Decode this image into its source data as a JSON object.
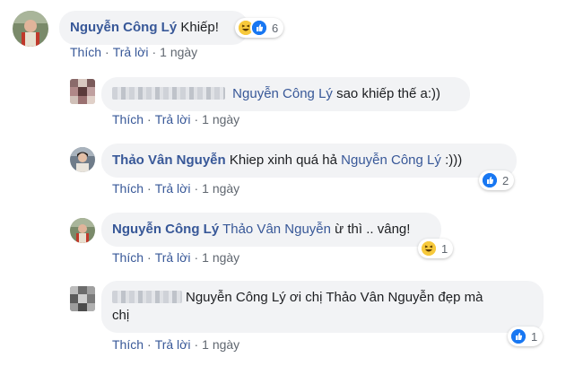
{
  "comments": [
    {
      "author": "Nguyễn Công Lý",
      "text": "Khiếp!",
      "actions": {
        "like": "Thích",
        "reply": "Trả lời",
        "time": "1 ngày"
      },
      "reactions": {
        "types": [
          "haha-icon",
          "like-icon"
        ],
        "count": "6"
      }
    },
    {
      "tag": "Nguyễn Công Lý",
      "text": "sao khiếp thế a:))",
      "actions": {
        "like": "Thích",
        "reply": "Trả lời",
        "time": "1 ngày"
      }
    },
    {
      "author": "Thảo Vân Nguyễn",
      "text": "Khiep xinh quá hả",
      "tag": "Nguyễn Công Lý",
      "suffix": ":)))",
      "actions": {
        "like": "Thích",
        "reply": "Trả lời",
        "time": "1 ngày"
      },
      "reactions": {
        "types": [
          "like-icon"
        ],
        "count": "2"
      }
    },
    {
      "author": "Nguyễn Công Lý",
      "tag": "Thảo Vân Nguyễn",
      "text": "ừ thì .. vâng!",
      "actions": {
        "like": "Thích",
        "reply": "Trả lời",
        "time": "1 ngày"
      },
      "reactions": {
        "types": [
          "haha-icon"
        ],
        "count": "1"
      }
    },
    {
      "text_line1": "Nguyễn Công Lý ơi chị Thảo Vân Nguyễn đẹp mà",
      "text_line2": "chị",
      "actions": {
        "like": "Thích",
        "reply": "Trả lời",
        "time": "1 ngày"
      },
      "reactions": {
        "types": [
          "like-icon"
        ],
        "count": "1"
      }
    }
  ],
  "colors": {
    "link": "#385898",
    "bubble": "#f2f3f5",
    "like": "#1877f2",
    "haha": "#f7c93b",
    "meta": "#606770"
  }
}
